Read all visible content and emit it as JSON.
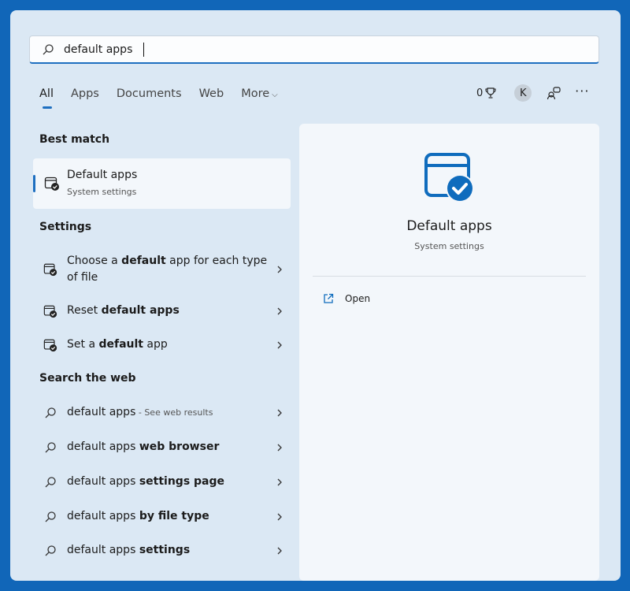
{
  "search": {
    "value": "default apps"
  },
  "tabs": [
    {
      "label": "All",
      "active": true
    },
    {
      "label": "Apps"
    },
    {
      "label": "Documents"
    },
    {
      "label": "Web"
    },
    {
      "label": "More"
    }
  ],
  "header": {
    "points": "0",
    "avatar_initial": "K"
  },
  "best_match": {
    "heading": "Best match",
    "title": "Default apps",
    "subtitle": "System settings"
  },
  "settings": {
    "heading": "Settings",
    "items": [
      {
        "pre": "Choose a ",
        "bold": "default",
        "post": " app for each type of file"
      },
      {
        "pre": "Reset ",
        "bold": "default apps",
        "post": ""
      },
      {
        "pre": "Set a ",
        "bold": "default",
        "post": " app"
      }
    ]
  },
  "web": {
    "heading": "Search the web",
    "items": [
      {
        "pre": "default apps",
        "bold": "",
        "sub": " - See web results"
      },
      {
        "pre": "default apps ",
        "bold": "web browser",
        "sub": ""
      },
      {
        "pre": "default apps ",
        "bold": "settings page",
        "sub": ""
      },
      {
        "pre": "default apps ",
        "bold": "by file type",
        "sub": ""
      },
      {
        "pre": "default apps ",
        "bold": "settings",
        "sub": ""
      }
    ]
  },
  "preview": {
    "title": "Default apps",
    "subtitle": "System settings",
    "open_label": "Open"
  },
  "colors": {
    "accent": "#1e6fc0",
    "background": "#1166b8",
    "panel": "#dbe8f4"
  }
}
